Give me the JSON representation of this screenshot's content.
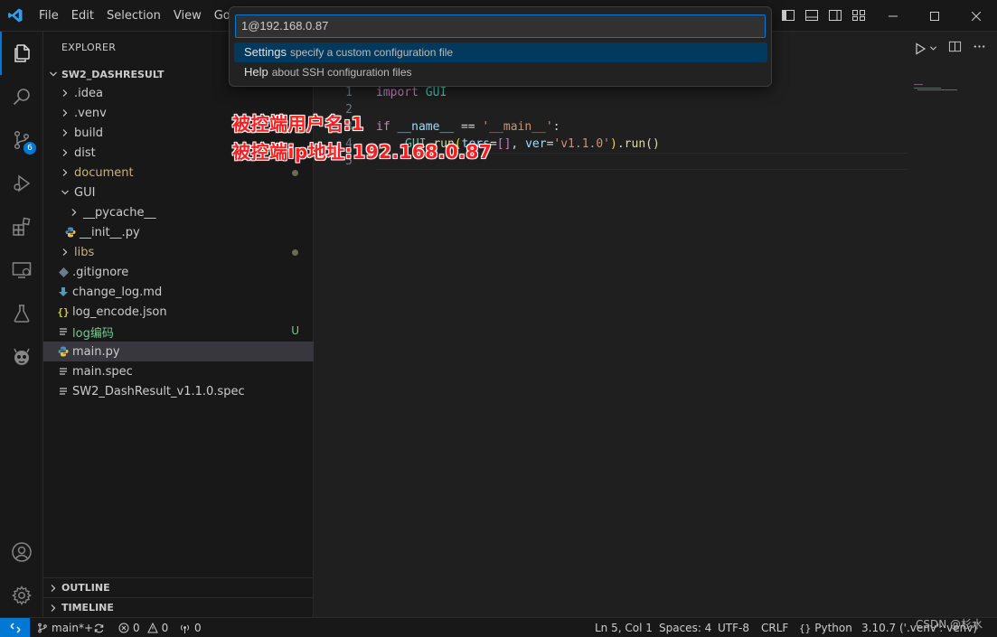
{
  "titlebar": {
    "menu": [
      "File",
      "Edit",
      "Selection",
      "View",
      "Go"
    ]
  },
  "activity": {
    "scm_badge": "6"
  },
  "sidebar": {
    "title": "EXPLORER",
    "folder": "SW2_DASHRESULT",
    "items": [
      {
        "label": ".idea",
        "type": "folder"
      },
      {
        "label": ".venv",
        "type": "folder"
      },
      {
        "label": "build",
        "type": "folder"
      },
      {
        "label": "dist",
        "type": "folder"
      },
      {
        "label": "document",
        "type": "folder",
        "status": "dot"
      },
      {
        "label": "GUI",
        "type": "folder-open"
      },
      {
        "label": "__pycache__",
        "type": "folder"
      },
      {
        "label": "__init__.py",
        "type": "python"
      },
      {
        "label": "libs",
        "type": "folder",
        "status": "dot"
      },
      {
        "label": ".gitignore",
        "type": "gitignore"
      },
      {
        "label": "change_log.md",
        "type": "markdown"
      },
      {
        "label": "log_encode.json",
        "type": "json"
      },
      {
        "label": "log编码",
        "type": "text",
        "status": "U"
      },
      {
        "label": "main.py",
        "type": "python",
        "selected": true
      },
      {
        "label": "main.spec",
        "type": "text"
      },
      {
        "label": "SW2_DashResult_v1.1.0.spec",
        "type": "text"
      }
    ],
    "outline": "OUTLINE",
    "timeline": "TIMELINE"
  },
  "quickpick": {
    "input_value": "1@192.168.0.87",
    "items": [
      {
        "label": "Settings",
        "description": "specify a custom configuration file"
      },
      {
        "label": "Help",
        "description": "about SSH configuration files"
      }
    ]
  },
  "editor": {
    "line_numbers": [
      "1",
      "2",
      "3",
      "4",
      "5"
    ],
    "line1": {
      "kw": "import",
      "mod": "GUI"
    },
    "line3": {
      "kw": "if",
      "var": "__name__",
      "op": "==",
      "str": "'__main__'",
      "colon": ":"
    },
    "line4": {
      "var": "GUI",
      "fn": "run",
      "kw_arg": "ters",
      "eq": "=",
      "list": "[]",
      "comma": ",",
      "ver": "ver",
      "ver_val": "'v1.1.0'",
      "tail": ".run()"
    }
  },
  "annotations": {
    "username": "被控端用户名:1",
    "ip": "被控端ip地址:192.168.0.87"
  },
  "statusbar": {
    "branch": "main*+",
    "errors": "0",
    "warnings": "0",
    "ports": "0",
    "position": "Ln 5, Col 1",
    "spaces": "Spaces: 4",
    "encoding": "UTF-8",
    "eol": "CRLF",
    "language": "Python",
    "interpreter": "3.10.7 ('.venv': venv)"
  },
  "watermark": "CSDN @杉水",
  "colors": {
    "accent": "#0078d4",
    "annotation": "#ff1e1e",
    "git_untracked": "#73c991"
  }
}
